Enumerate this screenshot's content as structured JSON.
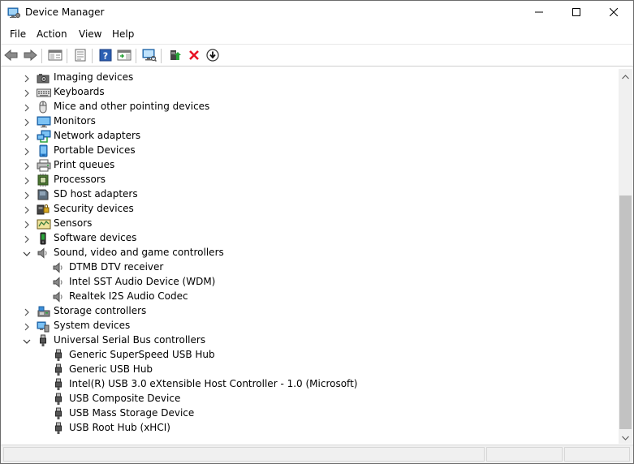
{
  "window": {
    "title": "Device Manager"
  },
  "menu": {
    "items": [
      "File",
      "Action",
      "View",
      "Help"
    ]
  },
  "toolbar": {
    "buttons": [
      "back-icon",
      "forward-icon",
      "show-hide-console-tree-icon",
      "properties-icon",
      "help-icon",
      "action-pane-icon",
      "scan-hardware-icon",
      "update-driver-icon",
      "uninstall-icon",
      "enable-device-icon"
    ]
  },
  "tree": {
    "rows": [
      {
        "label": "Imaging devices",
        "level": 0,
        "expanded": false,
        "icon": "camera-icon"
      },
      {
        "label": "Keyboards",
        "level": 0,
        "expanded": false,
        "icon": "keyboard-icon"
      },
      {
        "label": "Mice and other pointing devices",
        "level": 0,
        "expanded": false,
        "icon": "mouse-icon"
      },
      {
        "label": "Monitors",
        "level": 0,
        "expanded": false,
        "icon": "monitor-icon"
      },
      {
        "label": "Network adapters",
        "level": 0,
        "expanded": false,
        "icon": "network-adapter-icon"
      },
      {
        "label": "Portable Devices",
        "level": 0,
        "expanded": false,
        "icon": "portable-device-icon"
      },
      {
        "label": "Print queues",
        "level": 0,
        "expanded": false,
        "icon": "printer-icon"
      },
      {
        "label": "Processors",
        "level": 0,
        "expanded": false,
        "icon": "processor-icon"
      },
      {
        "label": "SD host adapters",
        "level": 0,
        "expanded": false,
        "icon": "sd-card-icon"
      },
      {
        "label": "Security devices",
        "level": 0,
        "expanded": false,
        "icon": "security-device-icon"
      },
      {
        "label": "Sensors",
        "level": 0,
        "expanded": false,
        "icon": "sensor-icon"
      },
      {
        "label": "Software devices",
        "level": 0,
        "expanded": false,
        "icon": "software-device-icon"
      },
      {
        "label": "Sound, video and game controllers",
        "level": 0,
        "expanded": true,
        "icon": "speaker-icon"
      },
      {
        "label": "DTMB DTV receiver",
        "level": 1,
        "icon": "speaker-icon"
      },
      {
        "label": "Intel SST Audio Device (WDM)",
        "level": 1,
        "icon": "speaker-icon"
      },
      {
        "label": "Realtek I2S Audio Codec",
        "level": 1,
        "icon": "speaker-icon"
      },
      {
        "label": "Storage controllers",
        "level": 0,
        "expanded": false,
        "icon": "storage-controller-icon"
      },
      {
        "label": "System devices",
        "level": 0,
        "expanded": false,
        "icon": "system-device-icon"
      },
      {
        "label": "Universal Serial Bus controllers",
        "level": 0,
        "expanded": true,
        "icon": "usb-icon"
      },
      {
        "label": "Generic SuperSpeed USB Hub",
        "level": 1,
        "icon": "usb-icon"
      },
      {
        "label": "Generic USB Hub",
        "level": 1,
        "icon": "usb-icon"
      },
      {
        "label": "Intel(R) USB 3.0 eXtensible Host Controller - 1.0 (Microsoft)",
        "level": 1,
        "icon": "usb-icon"
      },
      {
        "label": "USB Composite Device",
        "level": 1,
        "icon": "usb-icon"
      },
      {
        "label": "USB Mass Storage Device",
        "level": 1,
        "icon": "usb-icon"
      },
      {
        "label": "USB Root Hub (xHCI)",
        "level": 1,
        "icon": "usb-icon"
      }
    ]
  },
  "colors": {
    "help_blue": "#2b5fb3",
    "uninstall_red": "#e81123",
    "update_green": "#2aa33a",
    "scroll_thumb": "#c2c2c2"
  }
}
